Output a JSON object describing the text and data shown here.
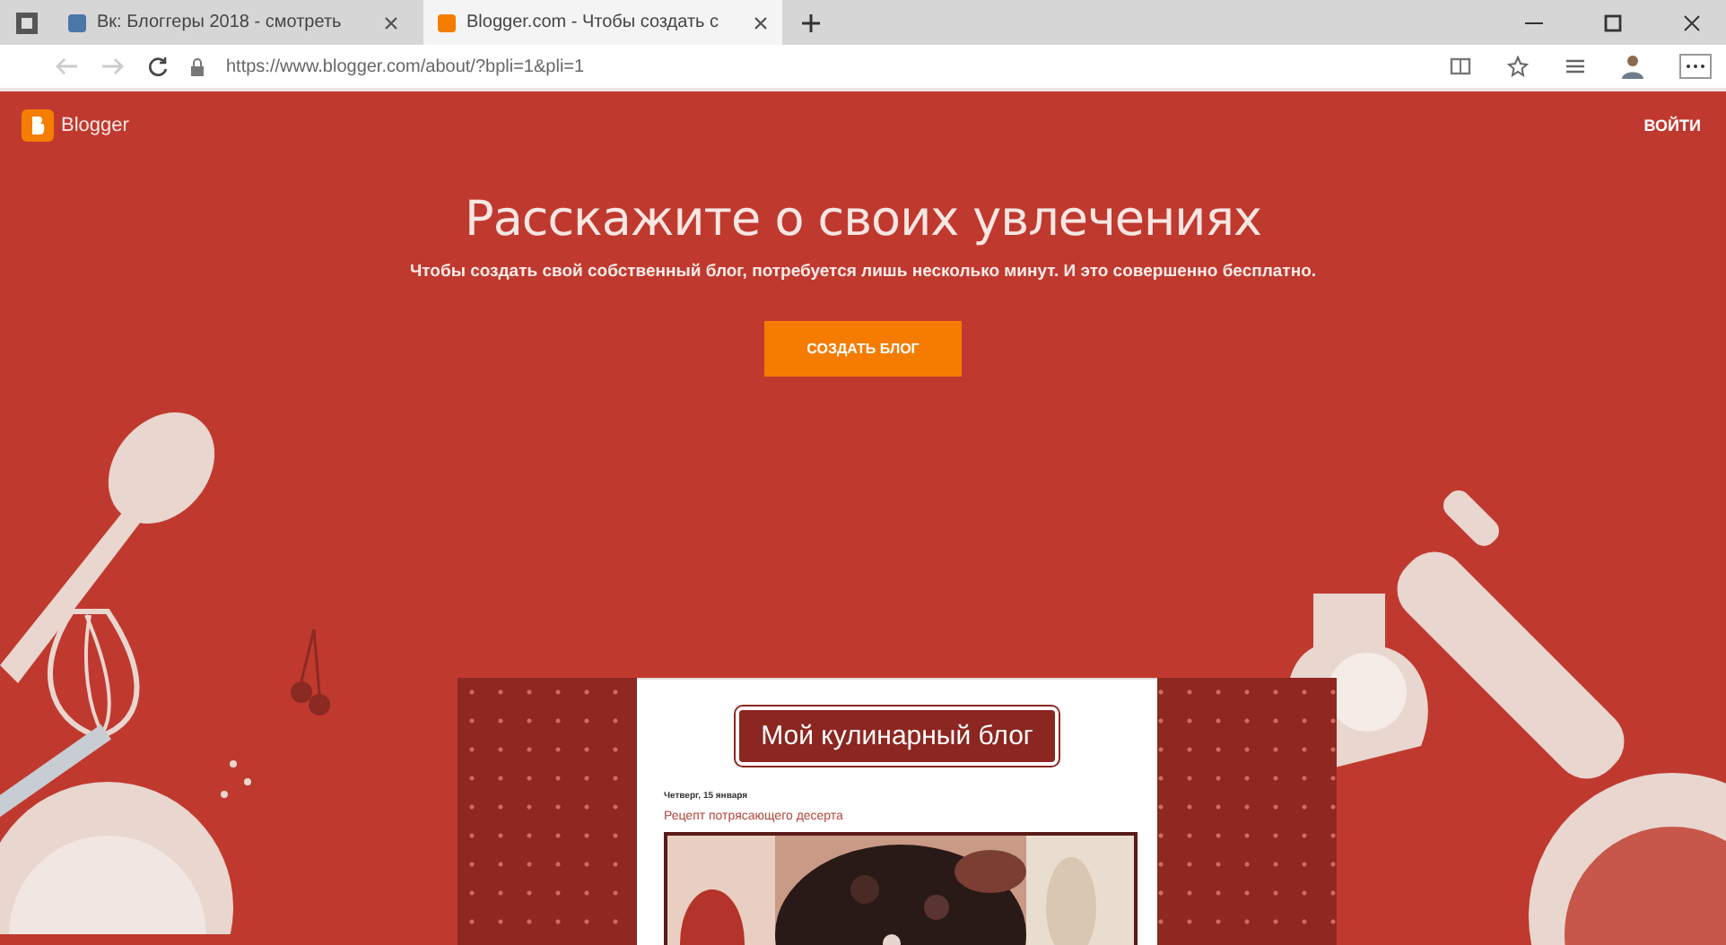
{
  "browser": {
    "tabs": [
      {
        "title": "Вк: Блоггеры 2018 - смотреть",
        "selected": false
      },
      {
        "title": "Blogger.com - Чтобы создать с",
        "selected": true
      }
    ],
    "address": "https://www.blogger.com/about/?bpli=1&pli=1"
  },
  "header": {
    "logo": "Blogger",
    "sign_in": "ВОЙТИ"
  },
  "hero": {
    "title": "Расскажите о своих увлечениях",
    "subtitle": "Чтобы создать свой собственный блог, потребуется лишь несколько минут. И это совершенно бесплатно.",
    "button": "СОЗДАТЬ БЛОГ"
  },
  "blog_preview": {
    "title": "Мой кулинарный блог",
    "date": "Четверг, 15 января",
    "post_title": "Рецепт потрясающего десерта"
  }
}
